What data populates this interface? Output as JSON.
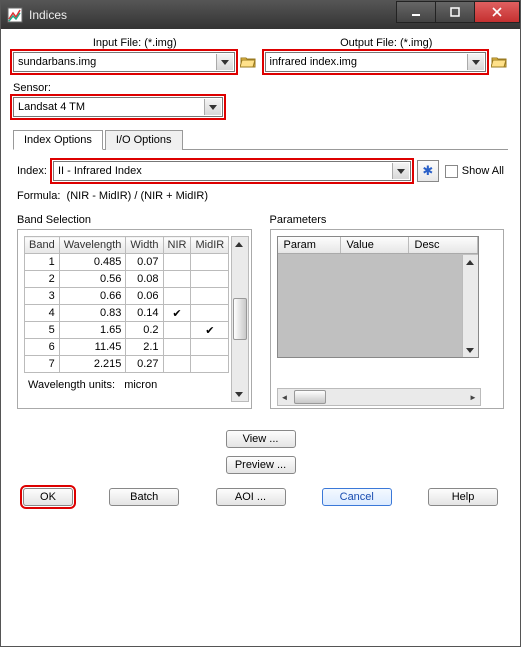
{
  "window": {
    "title": "Indices"
  },
  "io": {
    "input_label": "Input File: (*.img)",
    "output_label": "Output File: (*.img)",
    "input_value": "sundarbans.img",
    "output_value": "infrared index.img"
  },
  "sensor": {
    "label": "Sensor:",
    "value": "Landsat 4 TM"
  },
  "tabs": {
    "t0": "Index Options",
    "t1": "I/O Options"
  },
  "index": {
    "label": "Index:",
    "value": "II - Infrared Index",
    "showall": "Show All"
  },
  "formula": {
    "label": "Formula:",
    "text": "(NIR - MidIR) / (NIR + MidIR)"
  },
  "band_section": {
    "title": "Band Selection",
    "headers": {
      "band": "Band",
      "wl": "Wavelength",
      "width": "Width",
      "nir": "NIR",
      "midir": "MidIR"
    },
    "rows": [
      {
        "band": "1",
        "wl": "0.485",
        "width": "0.07",
        "nir": "",
        "midir": ""
      },
      {
        "band": "2",
        "wl": "0.56",
        "width": "0.08",
        "nir": "",
        "midir": ""
      },
      {
        "band": "3",
        "wl": "0.66",
        "width": "0.06",
        "nir": "",
        "midir": ""
      },
      {
        "band": "4",
        "wl": "0.83",
        "width": "0.14",
        "nir": "✔",
        "midir": ""
      },
      {
        "band": "5",
        "wl": "1.65",
        "width": "0.2",
        "nir": "",
        "midir": "✔"
      },
      {
        "band": "6",
        "wl": "11.45",
        "width": "2.1",
        "nir": "",
        "midir": ""
      },
      {
        "band": "7",
        "wl": "2.215",
        "width": "0.27",
        "nir": "",
        "midir": ""
      }
    ],
    "units_label": "Wavelength units:",
    "units_value": "micron"
  },
  "params_section": {
    "title": "Parameters",
    "headers": {
      "param": "Param",
      "value": "Value",
      "desc": "Desc"
    }
  },
  "buttons": {
    "view": "View ...",
    "preview": "Preview ...",
    "ok": "OK",
    "batch": "Batch",
    "aoi": "AOI ...",
    "cancel": "Cancel",
    "help": "Help"
  },
  "icons": {
    "star": "✱"
  }
}
